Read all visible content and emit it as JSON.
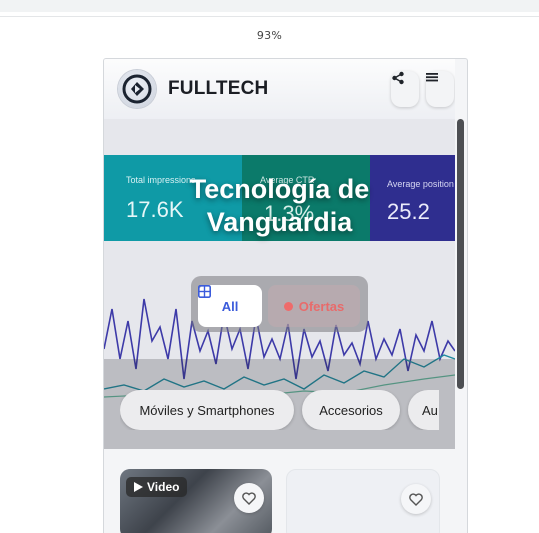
{
  "browser": {
    "zoom": "93%"
  },
  "header": {
    "brand": "FULLTECH",
    "share_icon": "share-icon",
    "menu_icon": "menu-icon"
  },
  "hero": {
    "title_line1": "Tecnología de",
    "title_line2": "Vanguardia",
    "background_stats": [
      {
        "label": "Total impressions",
        "value": "17.6K",
        "color": "#0f9aa6"
      },
      {
        "label": "Average CTR",
        "value": "1.3%",
        "color": "#0b7a6a"
      },
      {
        "label": "Average position",
        "value": "25.2",
        "color": "#2f2e8f"
      }
    ]
  },
  "filters": {
    "all_label": "All",
    "ofertas_label": "Ofertas"
  },
  "categories": [
    "Móviles y Smartphones",
    "Accesorios",
    "Au"
  ],
  "products": {
    "video_badge": "Video"
  },
  "colors": {
    "accent": "#3b5bdb",
    "offer": "#e86b6b"
  }
}
